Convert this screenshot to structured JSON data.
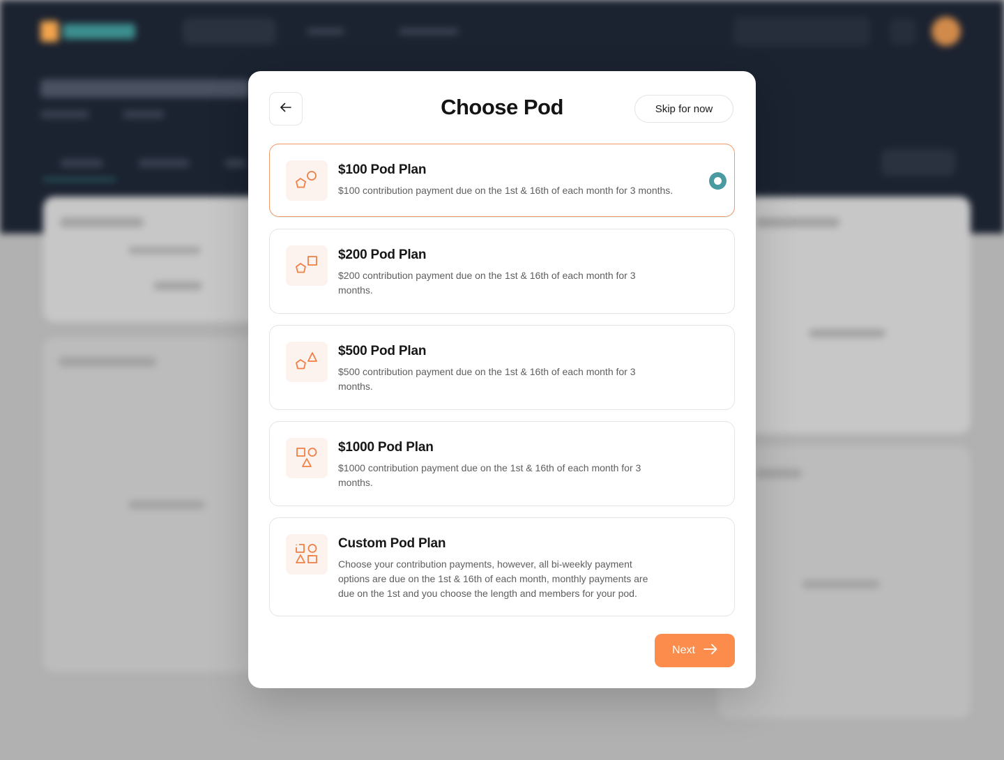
{
  "modal": {
    "title": "Choose Pod",
    "skip_label": "Skip for now",
    "next_label": "Next",
    "selected_plan_index": 0
  },
  "plans": [
    {
      "title": "$100 Pod Plan",
      "description": "$100 contribution payment due on the 1st & 16th of each month for 3 months.",
      "icon": "pentagon-circle-icon",
      "selected": true
    },
    {
      "title": "$200 Pod Plan",
      "description": "$200 contribution payment due on the 1st & 16th of each month for 3 months.",
      "icon": "pentagon-square-icon",
      "selected": false
    },
    {
      "title": "$500 Pod Plan",
      "description": "$500 contribution payment due on the 1st & 16th of each month for 3 months.",
      "icon": "pentagon-triangle-icon",
      "selected": false
    },
    {
      "title": "$1000 Pod Plan",
      "description": "$1000 contribution payment due on the 1st & 16th of each month for 3 months.",
      "icon": "square-circle-triangle-icon",
      "selected": false
    },
    {
      "title": "Custom Pod Plan",
      "description": "Choose your contribution payments, however, all bi-weekly payment options are due on the 1st & 16th of each month, monthly payments are due on the 1st and you choose the length and members for your pod.",
      "icon": "four-shapes-icon",
      "selected": false
    }
  ],
  "colors": {
    "accent": "#fb8c4c",
    "selected_border": "#f59a66",
    "radio": "#4a9ba1",
    "icon_stroke": "#f07f45",
    "icon_bg": "#fdf3ee"
  }
}
